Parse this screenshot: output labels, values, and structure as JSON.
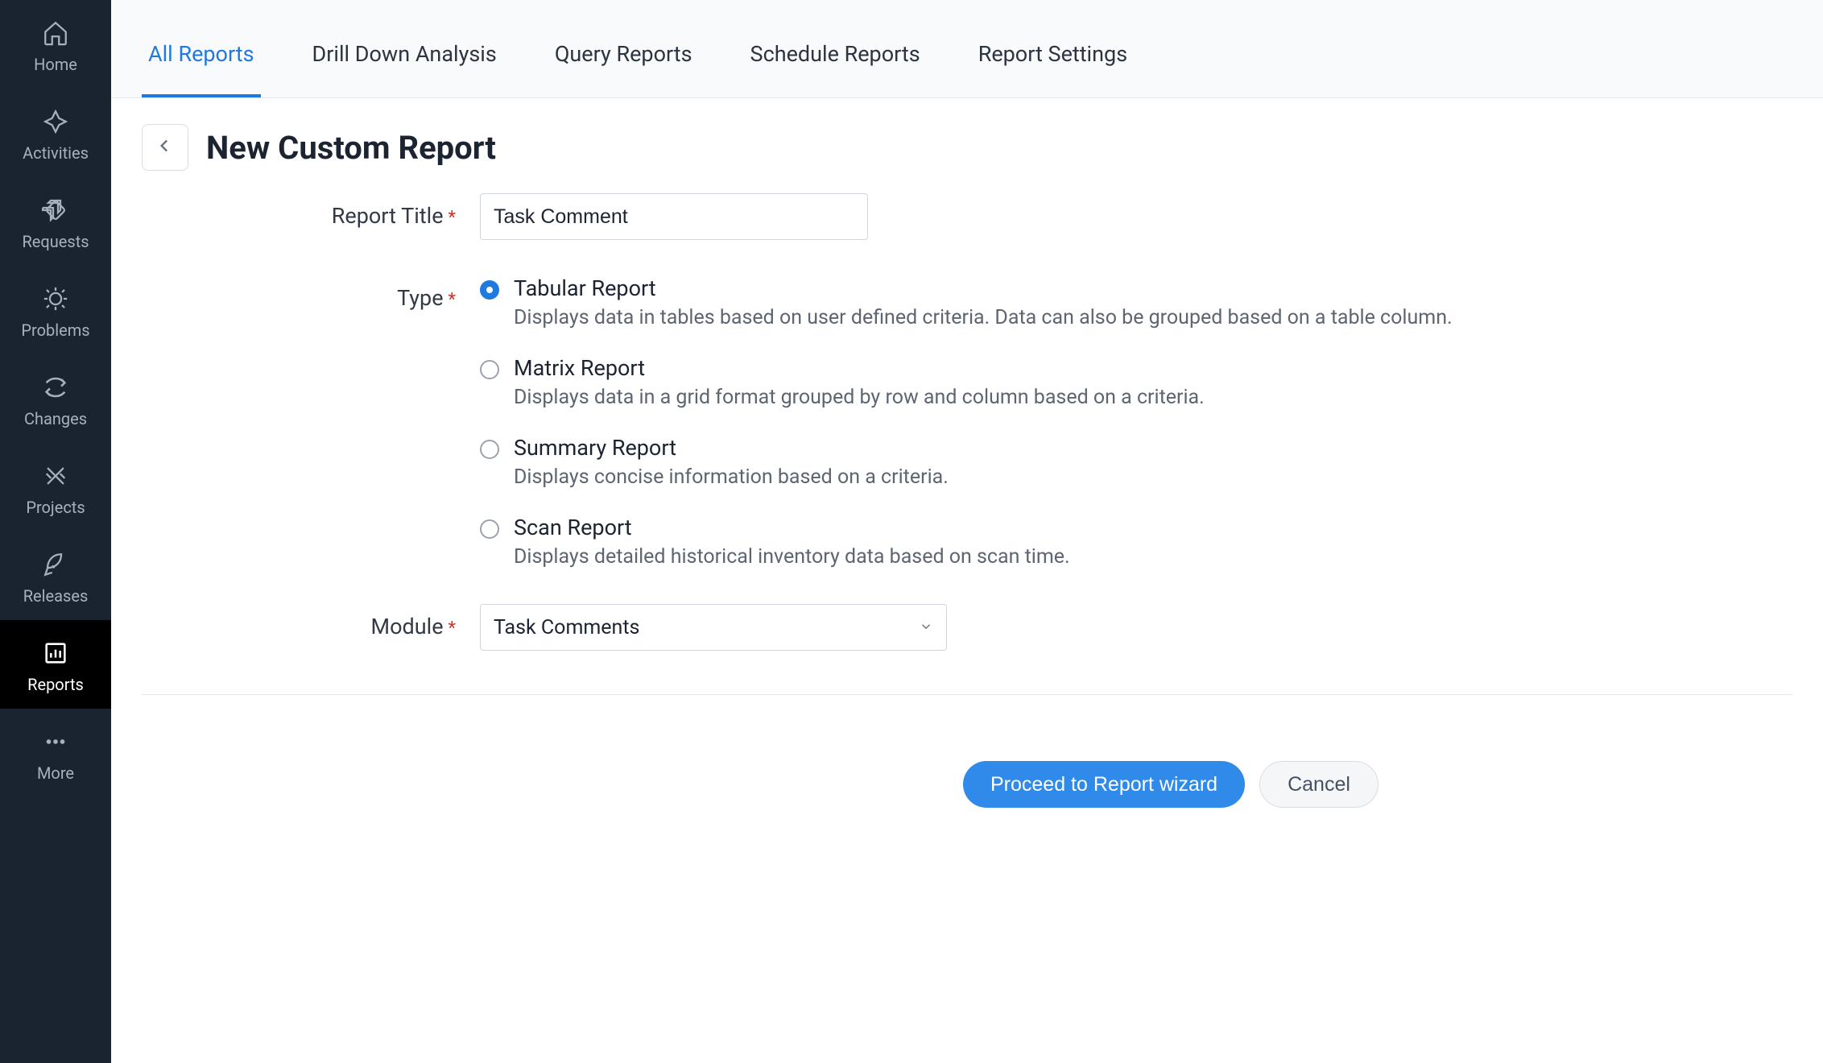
{
  "sidebar": {
    "items": [
      {
        "label": "Home",
        "icon": "home",
        "active": false
      },
      {
        "label": "Activities",
        "icon": "activities",
        "active": false
      },
      {
        "label": "Requests",
        "icon": "requests",
        "active": false
      },
      {
        "label": "Problems",
        "icon": "problems",
        "active": false
      },
      {
        "label": "Changes",
        "icon": "changes",
        "active": false
      },
      {
        "label": "Projects",
        "icon": "projects",
        "active": false
      },
      {
        "label": "Releases",
        "icon": "releases",
        "active": false
      },
      {
        "label": "Reports",
        "icon": "reports",
        "active": true
      },
      {
        "label": "More",
        "icon": "more",
        "active": false
      }
    ]
  },
  "tabs": [
    {
      "label": "All Reports",
      "active": true
    },
    {
      "label": "Drill Down Analysis",
      "active": false
    },
    {
      "label": "Query Reports",
      "active": false
    },
    {
      "label": "Schedule Reports",
      "active": false
    },
    {
      "label": "Report Settings",
      "active": false
    }
  ],
  "page": {
    "title": "New Custom Report"
  },
  "form": {
    "report_title": {
      "label": "Report Title",
      "value": "Task Comment",
      "required": true
    },
    "type": {
      "label": "Type",
      "required": true,
      "options": [
        {
          "title": "Tabular Report",
          "desc": "Displays data in tables based on user defined criteria. Data can also be grouped based on a table column.",
          "selected": true
        },
        {
          "title": "Matrix Report",
          "desc": "Displays data in a grid format grouped by row and column based on a criteria.",
          "selected": false
        },
        {
          "title": "Summary Report",
          "desc": "Displays concise information based on a criteria.",
          "selected": false
        },
        {
          "title": "Scan Report",
          "desc": "Displays detailed historical inventory data based on scan time.",
          "selected": false
        }
      ]
    },
    "module": {
      "label": "Module",
      "value": "Task Comments",
      "required": true
    }
  },
  "actions": {
    "proceed": "Proceed to Report wizard",
    "cancel": "Cancel"
  }
}
